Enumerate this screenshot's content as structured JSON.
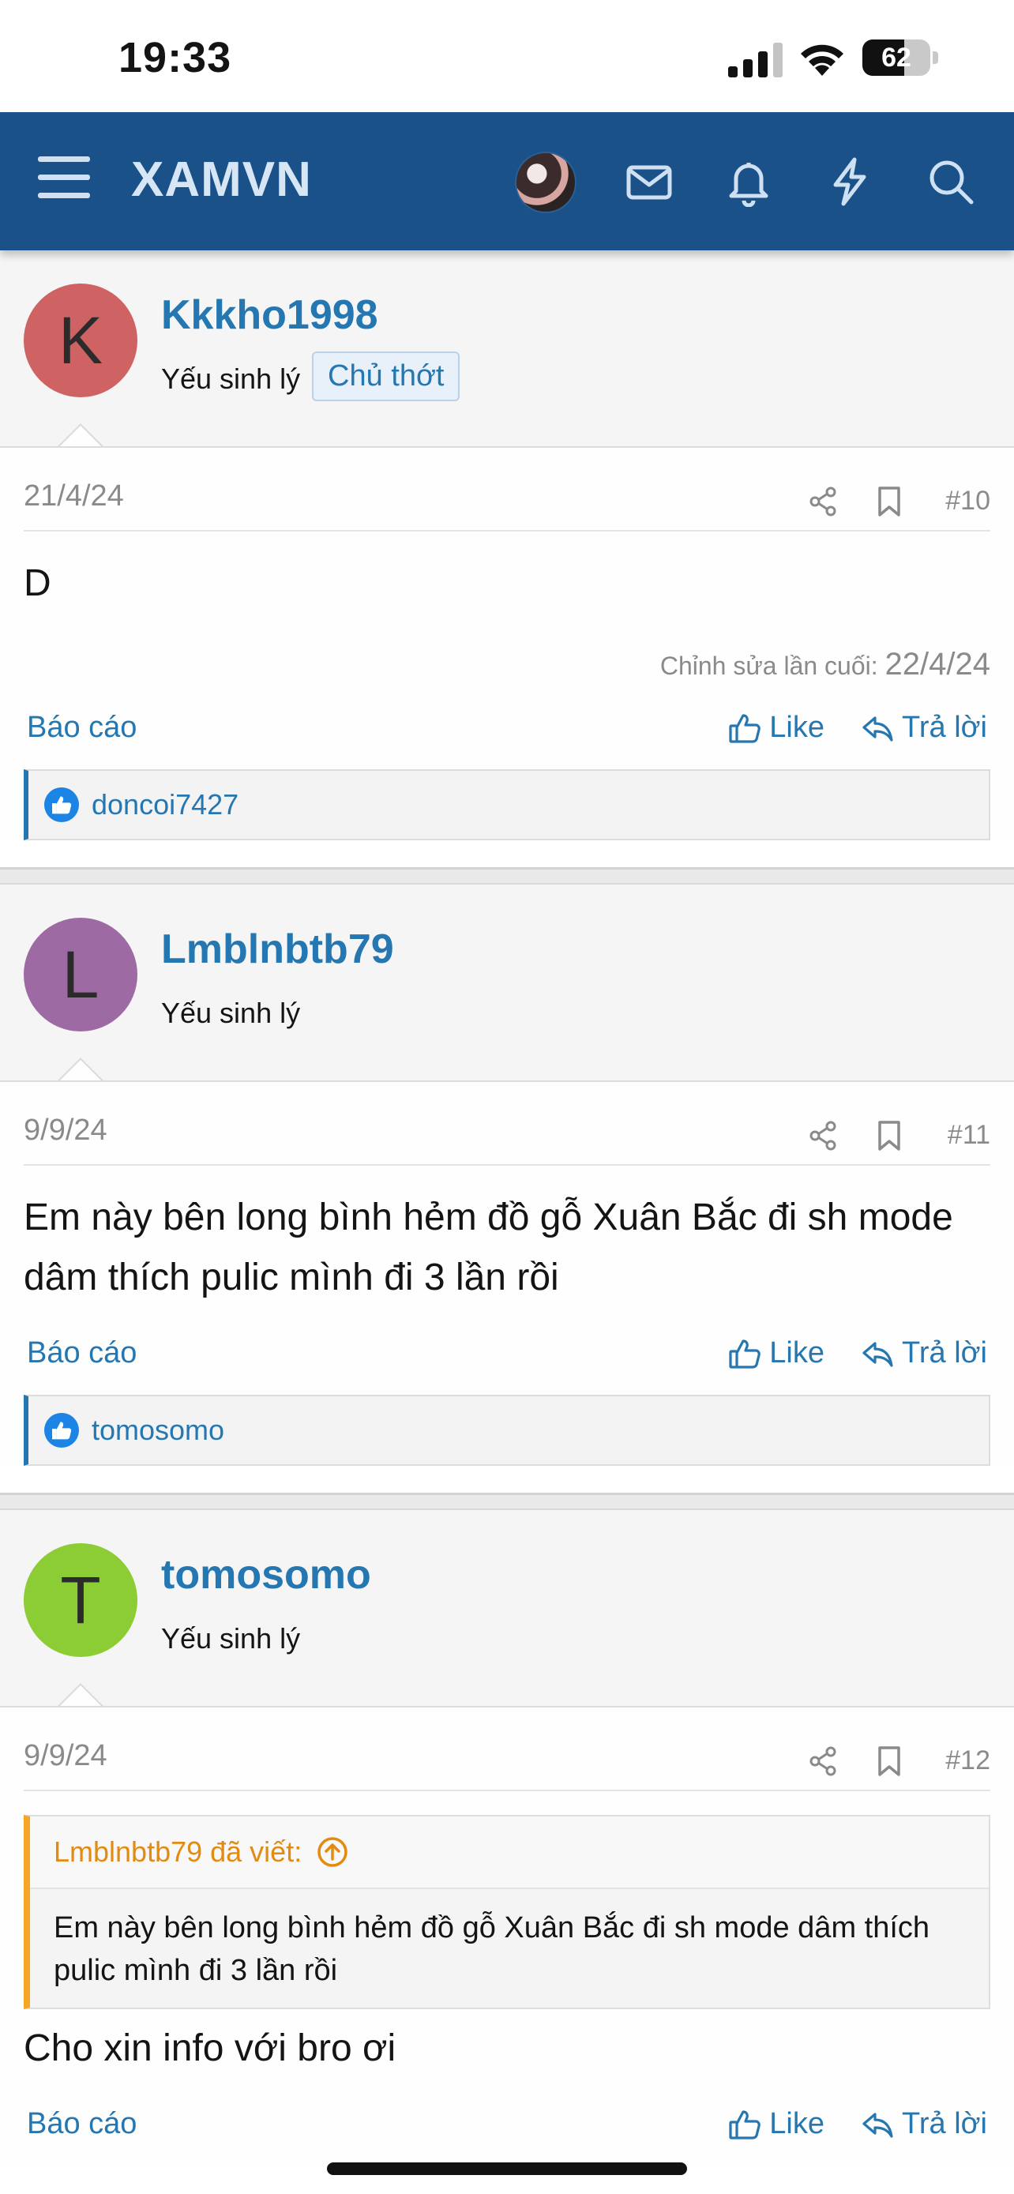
{
  "status_bar": {
    "time": "19:33",
    "battery": "62",
    "battery_level": 0.62
  },
  "header": {
    "brand": "XAMVN",
    "icons": [
      "menu-icon",
      "avatar",
      "mail-icon",
      "bell-icon",
      "bolt-icon",
      "search-icon"
    ],
    "color": "#1a5189"
  },
  "posts": [
    {
      "author": "Kkkho1998",
      "avatar_letter": "K",
      "avatar_color": "#cf6262",
      "user_title": "Yếu sinh lý",
      "badge": "Chủ thớt",
      "date": "21/4/24",
      "number": "#10",
      "message": "D",
      "edited_label": "Chỉnh sửa lần cuối:",
      "edited_date": "22/4/24",
      "report": "Báo cáo",
      "like": "Like",
      "reply": "Trả lời",
      "reaction_user": "doncoi7427"
    },
    {
      "author": "Lmblnbtb79",
      "avatar_letter": "L",
      "avatar_color": "#9d6aa3",
      "user_title": "Yếu sinh lý",
      "date": "9/9/24",
      "number": "#11",
      "message": "Em này bên long bình hẻm đồ gỗ Xuân Bắc đi sh mode dâm thích pulic mình đi 3 lần rồi",
      "report": "Báo cáo",
      "like": "Like",
      "reply": "Trả lời",
      "reaction_user": "tomosomo"
    },
    {
      "author": "tomosomo",
      "avatar_letter": "T",
      "avatar_color": "#8ccc35",
      "user_title": "Yếu sinh lý",
      "date": "9/9/24",
      "number": "#12",
      "quote_author": "Lmblnbtb79 đã viết:",
      "quote_text": "Em này bên long bình hẻm đồ gỗ Xuân Bắc đi sh mode dâm thích pulic mình đi 3 lần rồi",
      "message": "Cho xin info với bro ơi",
      "report": "Báo cáo",
      "like": "Like",
      "reply": "Trả lời"
    }
  ]
}
